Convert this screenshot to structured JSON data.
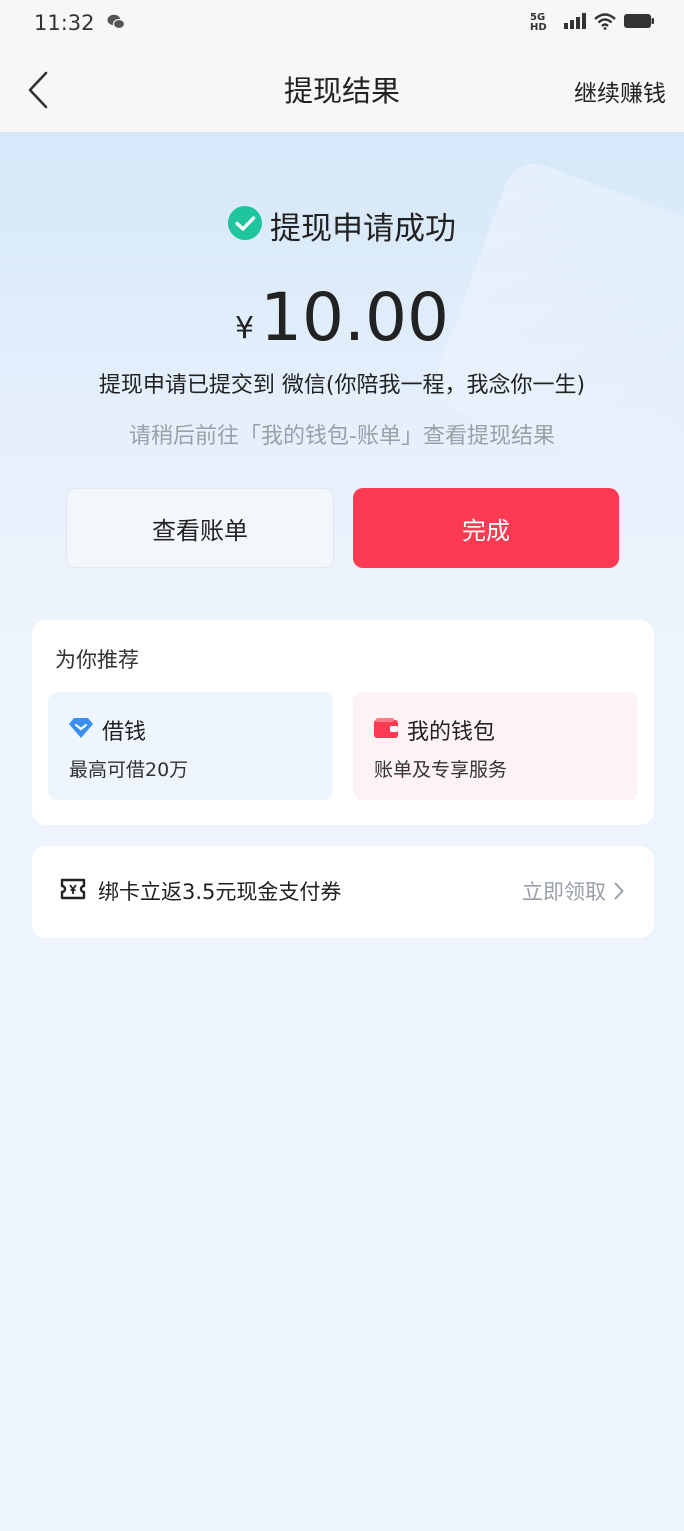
{
  "status_bar": {
    "time": "11:32",
    "network": "5G HD"
  },
  "nav": {
    "title": "提现结果",
    "right_action": "继续赚钱"
  },
  "result": {
    "status_text": "提现申请成功",
    "currency_symbol": "¥",
    "amount": "10.00",
    "submitted_text": "提现申请已提交到 微信(你陪我一程，我念你一生)",
    "hint_text": "请稍后前往「我的钱包-账单」查看提现结果"
  },
  "actions": {
    "view_bill": "查看账单",
    "done": "完成"
  },
  "recommend": {
    "title": "为你推荐",
    "items": [
      {
        "name": "借钱",
        "desc": "最高可借20万",
        "icon": "diamond-icon"
      },
      {
        "name": "我的钱包",
        "desc": "账单及专享服务",
        "icon": "wallet-icon"
      }
    ]
  },
  "promo": {
    "text": "绑卡立返3.5元现金支付券",
    "action": "立即领取",
    "icon": "ticket-icon"
  },
  "colors": {
    "primary": "#fc3a52",
    "success": "#1fc59c",
    "loan_icon": "#3a8ff0"
  }
}
